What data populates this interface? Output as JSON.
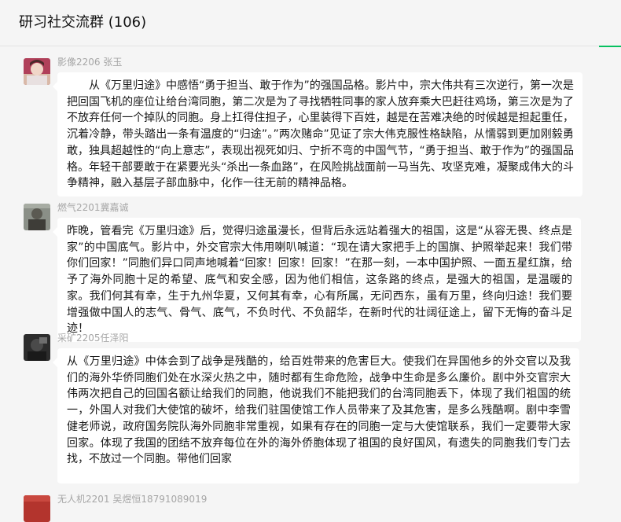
{
  "header": {
    "title": "研习社交流群 (106)"
  },
  "messages": [
    {
      "sender": "影像2206 张玉",
      "text": "从《万里归途》中感悟“勇于担当、敢于作为”的强国品格。影片中，宗大伟共有三次逆行，第一次是把回国飞机的座位让给台湾同胞，第二次是为了寻找牺牲同事的家人放弃乘大巴赶往鸡场，第三次是为了不放弃任何一个掉队的同胞。身上扛得住担子，心里装得下百姓，越是在苦难决绝的时候越是担起重任，沉着冷静，带头踏出一条有温度的“归途”。”两次赌命”见证了宗大伟克服性格缺陷，从懦弱到更加刚毅勇敢，独具超越性的“向上意志”，表现出视死如归、宁折不弯的中国气节，“勇于担当、敢于作为”的强国品格。年轻干部要敢于在紧要光头“杀出一条血路”，在风险挑战面前一马当先、攻坚克难，凝聚成伟大的斗争精神，融入基层子部血脉中，化作一往无前的精神品格。"
    },
    {
      "sender": "燃气2201冀嘉诚",
      "text": "昨晚，管看完《万里归途》后，觉得归途虽漫长，但背后永远站着强大的祖国，这是“从容无畏、终点是家”的中国底气。影片中，外交官宗大伟用喇叭喊道：“现在请大家把手上的国旗、护照举起来！我们带你们回家！”同胞们异口同声地喊着“回家！回家！回家！”在那一刻，一本中国护照、一面五星红旗，给予了海外同胞十足的希望、底气和安全感，因为他们相信，这条路的终点，是强大的祖国，是温暖的家。我们何其有幸，生于九州华夏，又何其有幸，心有所属，无问西东，虽有万里，终向归途！我们要增强做中国人的志气、骨气、底气，不负时代、不负韶华，在新时代的壮阔征途上，留下无悔的奋斗足迹！"
    },
    {
      "sender": "采矿2205任泽阳",
      "text": "从《万里归途》中体会到了战争是残酷的，给百姓带来的危害巨大。使我们在异国他乡的外交官以及我们的海外华侨同胞们处在水深火热之中，随时都有生命危险，战争中生命是多么廉价。剧中外交官宗大伟两次把自己的回国名额让给我们的同胞，他说我们不能把我们的台湾同胞丢下，体现了我们祖国的统一，外国人对我们大使馆的破坏，给我们驻国使馆工作人员带来了及其危害，是多么残酷啊。剧中李雪健老师说，政府国务院队海外同胞非常重视，如果有存在的同胞一定与大使馆联系，我们一定要带大家回家。体现了我国的团结不放弃每位在外的海外侨胞体现了祖国的良好国风，有遗失的同胞我们专门去找，不放过一个同胞。带他们回家"
    },
    {
      "sender": "无人机2201 吴煜恒18791089019"
    }
  ]
}
